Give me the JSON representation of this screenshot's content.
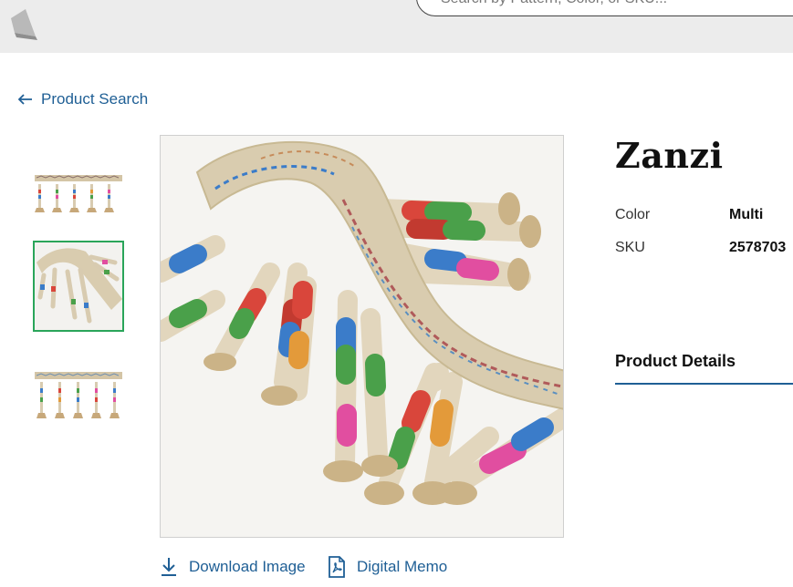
{
  "header": {
    "search_placeholder": "Search by Pattern, Color, or SKU..."
  },
  "nav": {
    "back_label": "Product Search"
  },
  "product": {
    "name": "Zanzi",
    "attributes": [
      {
        "label": "Color",
        "value": "Multi"
      },
      {
        "label": "SKU",
        "value": "2578703"
      }
    ],
    "details_tab": "Product Details"
  },
  "gallery": {
    "active_thumbnail": 2,
    "thumbnail_count": 3
  },
  "actions": {
    "download_label": "Download Image",
    "memo_label": "Digital Memo"
  },
  "colors": {
    "link": "#1f5f95",
    "active_thumb_border": "#2aa55a",
    "header_bg": "#ececec"
  }
}
